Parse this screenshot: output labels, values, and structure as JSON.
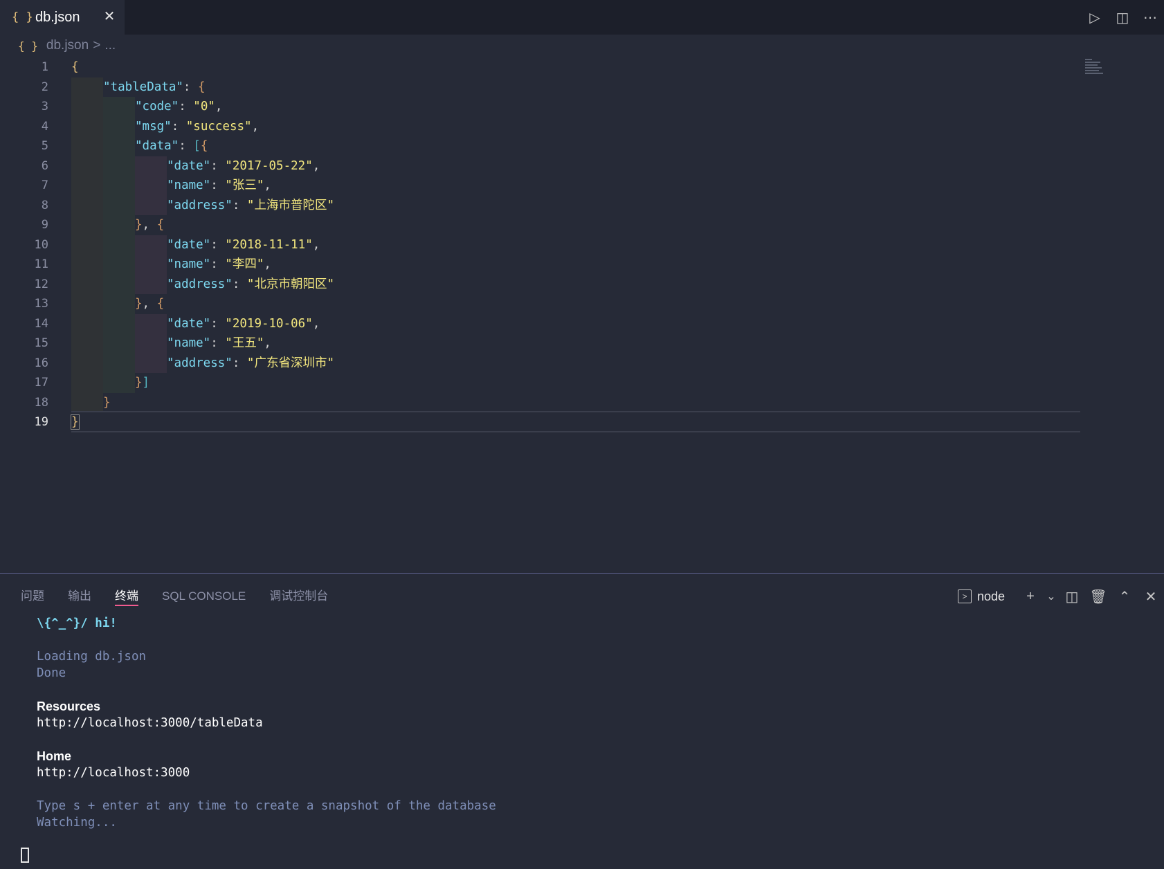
{
  "tab": {
    "icon": "{ }",
    "title": "db.json",
    "close": "✕"
  },
  "tab_actions": [
    "run-icon",
    "split-editor-icon",
    "more-actions-icon"
  ],
  "breadcrumb": {
    "icon": "{ }",
    "file": "db.json",
    "separator": ">",
    "more": "..."
  },
  "editor": {
    "line_numbers": [
      "1",
      "2",
      "3",
      "4",
      "5",
      "6",
      "7",
      "8",
      "9",
      "10",
      "11",
      "12",
      "13",
      "14",
      "15",
      "16",
      "17",
      "18",
      "19"
    ],
    "lines": {
      "l2": {
        "key": "\"tableData\""
      },
      "l3": {
        "key": "\"code\"",
        "val": "\"0\""
      },
      "l4": {
        "key": "\"msg\"",
        "val": "\"success\""
      },
      "l5": {
        "key": "\"data\""
      },
      "l6": {
        "key": "\"date\"",
        "val": "\"2017-05-22\""
      },
      "l7": {
        "key": "\"name\"",
        "val": "\"张三\""
      },
      "l8": {
        "key": "\"address\"",
        "val": "\"上海市普陀区\""
      },
      "l10": {
        "key": "\"date\"",
        "val": "\"2018-11-11\""
      },
      "l11": {
        "key": "\"name\"",
        "val": "\"李四\""
      },
      "l12": {
        "key": "\"address\"",
        "val": "\"北京市朝阳区\""
      },
      "l14": {
        "key": "\"date\"",
        "val": "\"2019-10-06\""
      },
      "l15": {
        "key": "\"name\"",
        "val": "\"王五\""
      },
      "l16": {
        "key": "\"address\"",
        "val": "\"广东省深圳市\""
      }
    }
  },
  "panel": {
    "tabs": [
      "问题",
      "输出",
      "终端",
      "SQL CONSOLE",
      "调试控制台"
    ],
    "active_tab": "终端",
    "terminal_kind": "node",
    "add_label": "+",
    "dropdown_label": "⌄",
    "accent_color": "#f25b8f"
  },
  "terminal": {
    "greeting": "\\{^_^}/ hi!",
    "loading": "Loading db.json",
    "done": "Done",
    "resources_label": "Resources",
    "resources_url": "http://localhost:3000/tableData",
    "home_label": "Home",
    "home_url": "http://localhost:3000",
    "hint": "Type s + enter at any time to create a snapshot of the database",
    "watching": "Watching..."
  }
}
